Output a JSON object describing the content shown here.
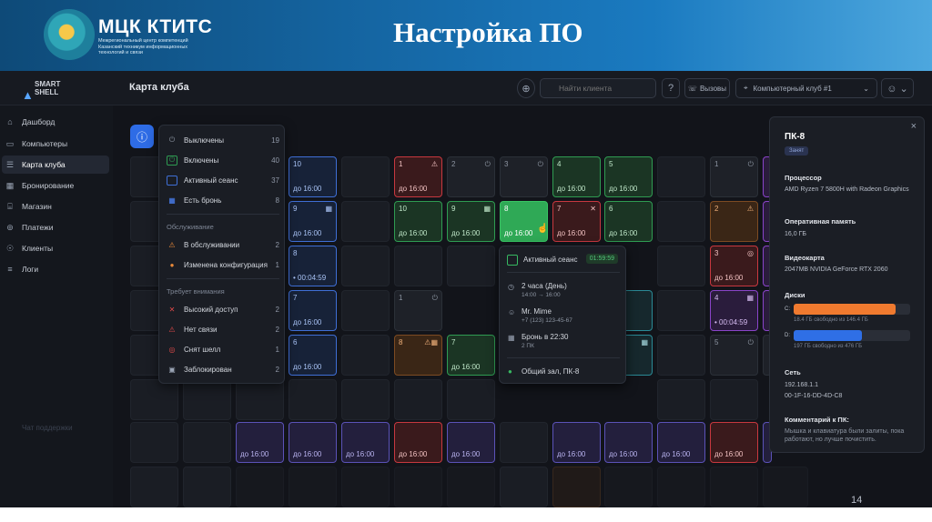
{
  "slide": {
    "org_name": "МЦК КТИТС",
    "org_sub": "Межрегиональный центр компетенций Казанский техникум информационных технологий и связи",
    "title": "Настройка ПО",
    "page_number": "14"
  },
  "app": {
    "brand": "SMART SHELL",
    "page_heading": "Карта клуба",
    "search_placeholder": "Найти клиента",
    "calls_label": "Вызовы",
    "club_label": "Компьютерный клуб #1",
    "support_label": "Чат поддержки",
    "colors": {
      "accent": "#2e6ce6",
      "active": "#2f9c52",
      "busy": "#3f6fd6",
      "alert": "#c8383f",
      "reserved": "#8a44c9"
    }
  },
  "sidebar": {
    "items": [
      {
        "label": "Дашборд",
        "icon": "home-icon"
      },
      {
        "label": "Компьютеры",
        "icon": "monitor-icon"
      },
      {
        "label": "Карта клуба",
        "icon": "map-icon"
      },
      {
        "label": "Бронирование",
        "icon": "calendar-icon"
      },
      {
        "label": "Магазин",
        "icon": "store-icon"
      },
      {
        "label": "Платежи",
        "icon": "payment-icon"
      },
      {
        "label": "Клиенты",
        "icon": "users-icon"
      },
      {
        "label": "Логи",
        "icon": "list-icon"
      }
    ]
  },
  "filter": {
    "status": [
      {
        "label": "Выключены",
        "count": "19"
      },
      {
        "label": "Включены",
        "count": "40"
      },
      {
        "label": "Активный сеанс",
        "count": "37"
      },
      {
        "label": "Есть бронь",
        "count": "8"
      }
    ],
    "maintenance_title": "Обслуживание",
    "maintenance": [
      {
        "label": "В обслуживании",
        "count": "2"
      },
      {
        "label": "Изменена конфигурация",
        "count": "1"
      }
    ],
    "attention_title": "Требует внимания",
    "attention": [
      {
        "label": "Высокий доступ",
        "count": "2"
      },
      {
        "label": "Нет связи",
        "count": "2"
      },
      {
        "label": "Снят шелл",
        "count": "1"
      },
      {
        "label": "Заблокирован",
        "count": "2"
      }
    ]
  },
  "pcs": [
    {
      "num": "10",
      "time": "до 16:00"
    },
    {
      "num": "1",
      "time": "до 16:00"
    },
    {
      "num": "2",
      "time": ""
    },
    {
      "num": "3",
      "time": ""
    },
    {
      "num": "4",
      "time": "до 16:00"
    },
    {
      "num": "5",
      "time": "до 16:00"
    },
    {
      "num": "1",
      "time": ""
    },
    {
      "num": "9",
      "time": "до 16:00"
    },
    {
      "num": "10",
      "time": "до 16:00"
    },
    {
      "num": "9",
      "time": "до 16:00"
    },
    {
      "num": "8",
      "time": "до 16:00"
    },
    {
      "num": "7",
      "time": "до 16:00"
    },
    {
      "num": "6",
      "time": "до 16:00"
    },
    {
      "num": "2",
      "time": ""
    },
    {
      "num": "8",
      "time": "• 00:04:59"
    },
    {
      "num": "3",
      "time": "до 16:00"
    },
    {
      "num": "7",
      "time": "до 16:00"
    },
    {
      "num": "1",
      "time": ""
    },
    {
      "num": "4",
      "time": "• 00:04:59"
    },
    {
      "num": "6",
      "time": "до 16:00"
    },
    {
      "num": "8",
      "time": ""
    },
    {
      "num": "7",
      "time": "до 16:00"
    },
    {
      "num": "5",
      "time": ""
    },
    {
      "num": "до 16:00",
      "time": ""
    }
  ],
  "popup": {
    "header": "Активный сеанс",
    "timer": "01:59:59",
    "duration": "2 часа (День)",
    "duration_range": "14:00 → 16:00",
    "client": "Mr. Mime",
    "phone": "+7 (123) 123-45-67",
    "booking": "Бронь в 22:30",
    "booking_sub": "2 ПК",
    "location": "Общий зал, ПК-8"
  },
  "details": {
    "title": "ПК-8",
    "status": "Занят",
    "cpu_label": "Процессор",
    "cpu": "AMD Ryzen 7 5800H with Radeon Graphics",
    "ram_label": "Оперативная память",
    "ram": "16,0 ГБ",
    "gpu_label": "Видеокарта",
    "gpu": "2047MB NVIDIA GeForce RTX 2060",
    "disks_label": "Диски",
    "disk_c": "C:",
    "disk_c_free": "18.4 ГБ свободно из 146.4 ГБ",
    "disk_c_used_fraction": 0.874,
    "disk_d": "D:",
    "disk_d_free": "197 ГБ свободно из 476 ГБ",
    "disk_d_used_fraction": 0.586,
    "net_label": "Сеть",
    "ip": "192.168.1.1",
    "mac": "00-1F-16-DD-4D-C8",
    "comment_label": "Комментарий к ПК:",
    "comment": "Мышка и клавиатура были залиты, пока работают, но лучше почистить."
  }
}
